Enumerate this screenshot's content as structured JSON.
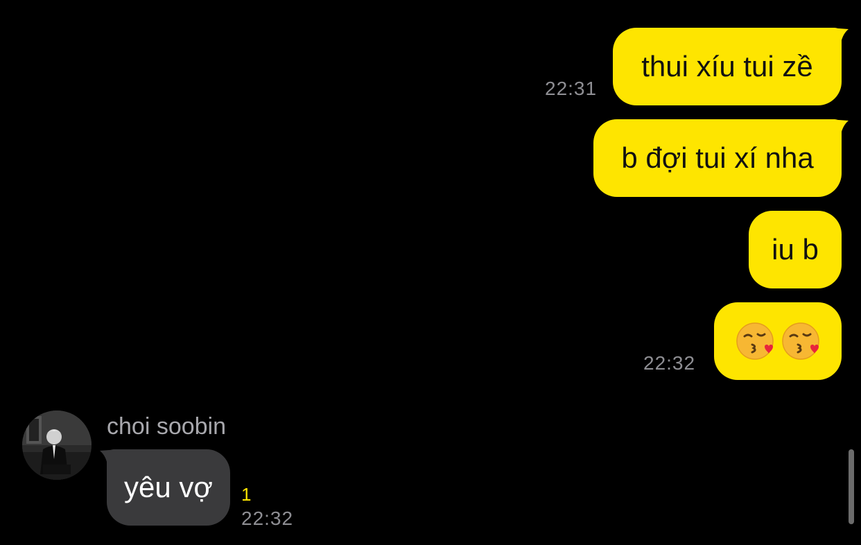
{
  "messages_sent": [
    {
      "text": "thui xíu tui zề",
      "time": "22:31"
    },
    {
      "text": "b đợi tui xí nha"
    },
    {
      "text": "iu b"
    },
    {
      "emoji": [
        "kissing-face-with-heart",
        "kissing-face-with-heart"
      ],
      "time": "22:32"
    }
  ],
  "received": {
    "sender_name": "choi soobin",
    "text": "yêu vợ",
    "unread_count": "1",
    "time": "22:32"
  },
  "colors": {
    "sent_bubble": "#FEE500",
    "received_bubble": "#3A3A3C",
    "background": "#000000",
    "timestamp": "#8E8E93"
  }
}
